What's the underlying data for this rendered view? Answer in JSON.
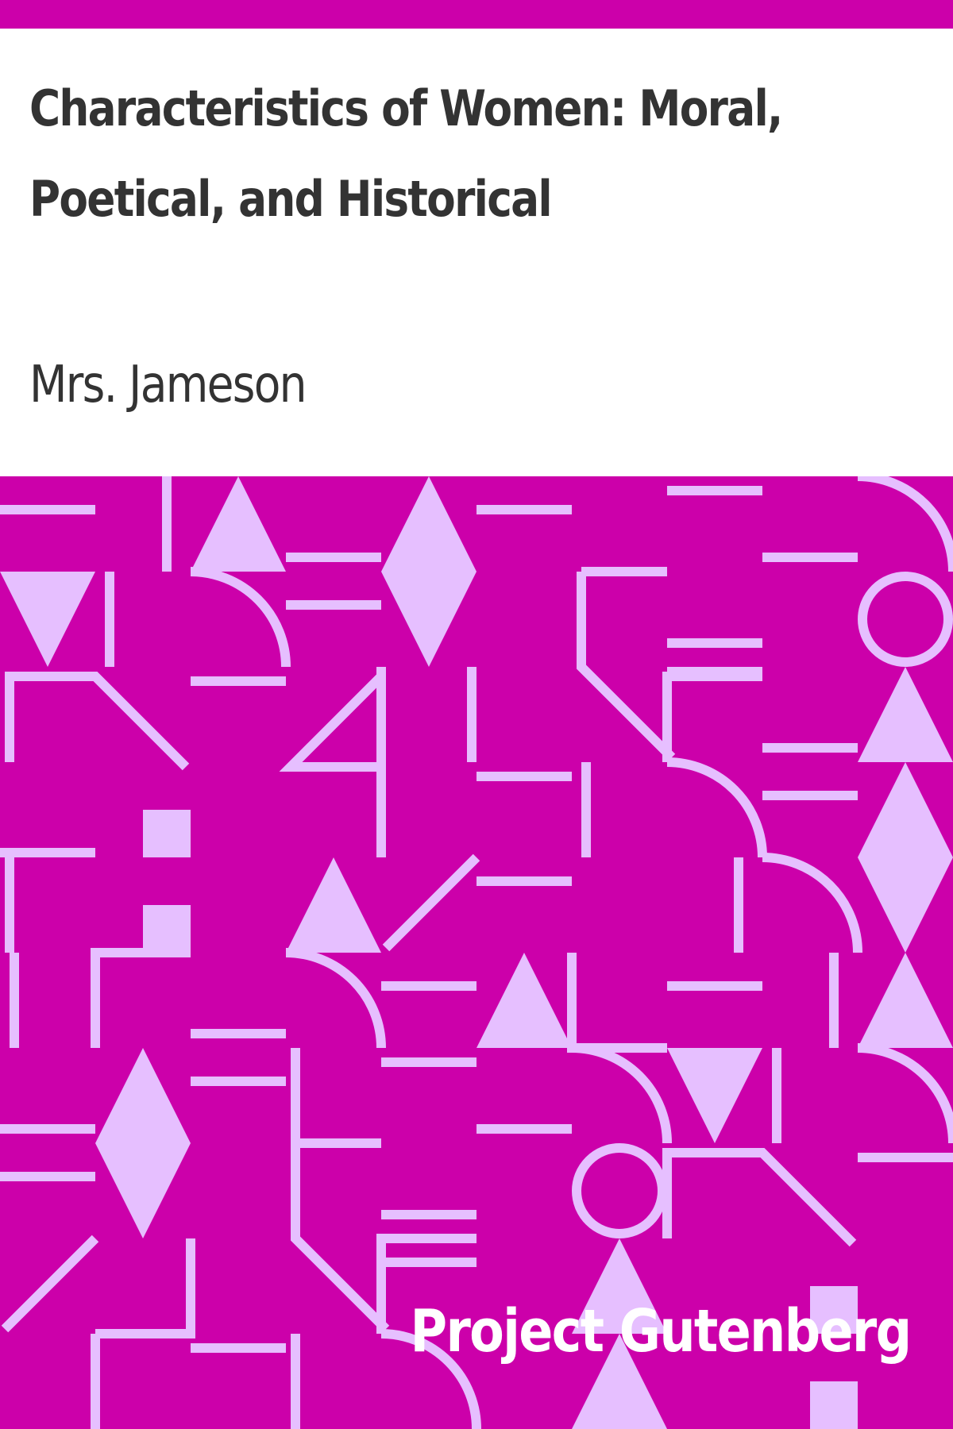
{
  "book": {
    "title": "Characteristics of Women: Moral, Poetical, and Historical",
    "author": "Mrs. Jameson",
    "publisher": "Project Gutenberg"
  },
  "colors": {
    "brand": "#cc00aa",
    "pattern_shape": "#e6bfff",
    "title_text": "#333333",
    "publisher_text": "#ffffff"
  },
  "pattern": {
    "motifs": [
      "horizontal-bars",
      "vertical-bars",
      "triangles",
      "diamonds",
      "circles",
      "quarter-arcs",
      "squares",
      "diagonal-lines"
    ]
  }
}
